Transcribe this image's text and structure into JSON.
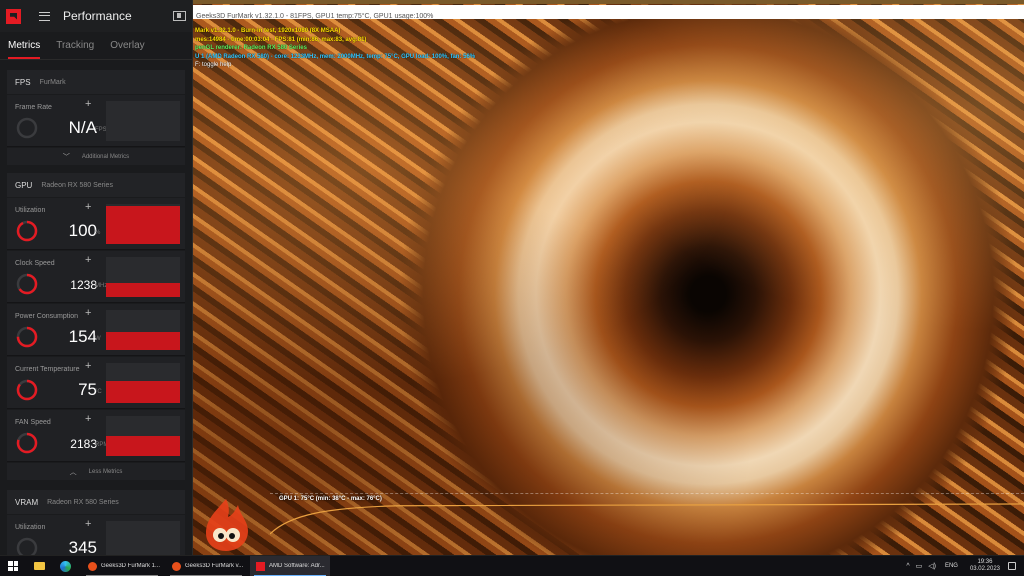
{
  "furmark": {
    "window_title": "Geeks3D FurMark v1.32.1.0 - 81FPS, GPU1 temp:75°C, GPU1 usage:100%",
    "osd": {
      "line1": "Mark v1.32.1.0 - Burn-in test, 1920x1080 (8X MSAA)",
      "line2": "mes:14984 - time:00:03:04 - FPS:81 (min:86, max:83, avg:81)",
      "line3": "penGL renderer: Radeon RX 580 Series",
      "line4": "U 1 (AMD Radeon RX 580) - core: 1233MHz, mem: 2000MHz, temp: 75°C, GPU load: 100%, fan: 56%",
      "line5": "F: toggle help"
    },
    "graph_label": "GPU 1: 75°C (min: 38°C - max: 76°C)"
  },
  "panel": {
    "title": "Performance",
    "tabs": [
      "Metrics",
      "Tracking",
      "Overlay"
    ],
    "fps_section": {
      "title": "FPS",
      "subtitle": "FurMark",
      "frame_rate": {
        "label": "Frame Rate",
        "value": "N/A",
        "unit": "FPS"
      },
      "more_label": "Additional Metrics"
    },
    "gpu_section": {
      "title": "GPU",
      "subtitle": "Radeon RX 580 Series",
      "metrics": [
        {
          "label": "Utilization",
          "value": "100",
          "unit": "%",
          "level": 0.95
        },
        {
          "label": "Clock Speed",
          "value": "1238",
          "unit": "MHz",
          "level": 0.35
        },
        {
          "label": "Power Consumption",
          "value": "154",
          "unit": "W",
          "level": 0.45
        },
        {
          "label": "Current Temperature",
          "value": "75",
          "unit": "°C",
          "level": 0.55
        },
        {
          "label": "FAN Speed",
          "value": "2183",
          "unit": "RPM",
          "level": 0.5
        }
      ],
      "less_label": "Less Metrics"
    },
    "vram_section": {
      "title": "VRAM",
      "subtitle": "Radeon RX 580 Series",
      "utilization": {
        "label": "Utilization",
        "value": "345",
        "unit": ""
      }
    }
  },
  "taskbar": {
    "tasks": [
      "Geeks3D FurMark 1...",
      "Geeks3D FurMark v...",
      "AMD Software: Adr..."
    ],
    "language": "ENG",
    "time": "19:36",
    "date": "03.02.2023"
  },
  "colors": {
    "accent": "#e41b23",
    "chart_fill": "#c8161c"
  }
}
